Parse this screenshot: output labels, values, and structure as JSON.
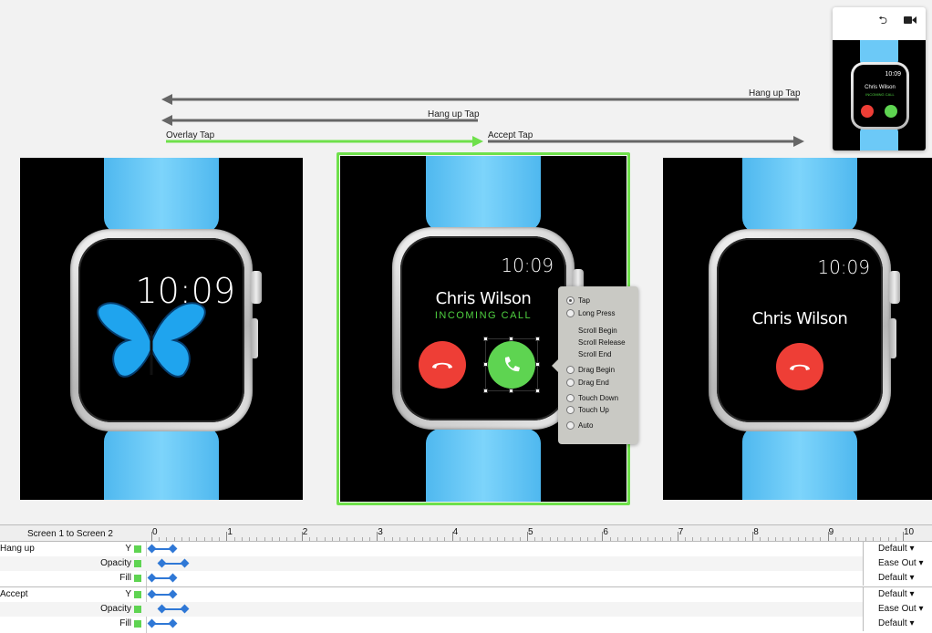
{
  "transitions": {
    "hang_up_tap_1": "Hang up Tap",
    "hang_up_tap_2": "Hang up Tap",
    "overlay_tap": "Overlay Tap",
    "accept_tap": "Accept Tap"
  },
  "screens": {
    "home": {
      "time": "10:09"
    },
    "incoming": {
      "time": "10:09",
      "caller": "Chris Wilson",
      "status": "INCOMING CALL"
    },
    "in_call": {
      "time": "10:09",
      "caller": "Chris Wilson"
    }
  },
  "trigger_menu": {
    "tap": "Tap",
    "long_press": "Long Press",
    "scroll_begin": "Scroll Begin",
    "scroll_release": "Scroll Release",
    "scroll_end": "Scroll End",
    "drag_begin": "Drag Begin",
    "drag_end": "Drag End",
    "touch_down": "Touch Down",
    "touch_up": "Touch Up",
    "auto": "Auto",
    "selected": "Tap"
  },
  "preview": {
    "undo_icon": "undo-icon",
    "record_icon": "video-camera-icon",
    "time": "10:09",
    "caller": "Chris Wilson",
    "status": "INCOMING CALL"
  },
  "timeline": {
    "title": "Screen 1 to Screen 2",
    "ticks": [
      "0",
      "1",
      "2",
      "3",
      "4",
      "5",
      "6",
      "7",
      "8",
      "9",
      "10"
    ],
    "groups": [
      {
        "name": "Hang up",
        "rows": [
          {
            "prop": "Y",
            "ease": "Default"
          },
          {
            "prop": "Opacity",
            "ease": "Ease Out"
          },
          {
            "prop": "Fill",
            "ease": "Default"
          }
        ]
      },
      {
        "name": "Accept",
        "rows": [
          {
            "prop": "Y",
            "ease": "Default"
          },
          {
            "prop": "Opacity",
            "ease": "Ease Out"
          },
          {
            "prop": "Fill",
            "ease": "Default"
          }
        ]
      }
    ]
  },
  "colors": {
    "accent_green": "#6fe04b",
    "band_blue": "#6cc9f7",
    "hangup_red": "#ee3e36",
    "accept_green": "#5ed451",
    "keyframe_blue": "#2f78d6"
  }
}
